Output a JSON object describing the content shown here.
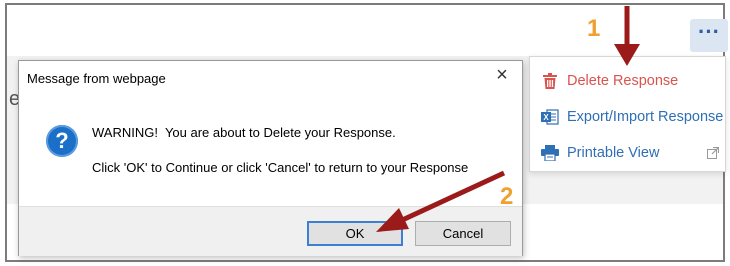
{
  "page": {
    "fragment_text": "e"
  },
  "more_button": {
    "label": "···",
    "icon": "more-horizontal-icon"
  },
  "menu": {
    "items": [
      {
        "label": "Delete Response",
        "icon": "trash-icon",
        "color": "#d9534f"
      },
      {
        "label": "Export/Import Response",
        "icon": "excel-icon",
        "color": "#2e6fb5"
      },
      {
        "label": "Printable View",
        "icon": "printer-icon",
        "color": "#2e6fb5",
        "trailing_icon": "external-link-icon"
      }
    ]
  },
  "dialog": {
    "title": "Message from webpage",
    "close_label": "×",
    "icon": "question-icon",
    "icon_glyph": "?",
    "message_line1": "WARNING!  You are about to Delete your Response.",
    "message_line2": "Click 'OK' to Continue or click 'Cancel' to return to your Response",
    "ok_label": "OK",
    "cancel_label": "Cancel"
  },
  "annotations": {
    "step1": "1",
    "step2": "2",
    "arrow_color": "#9b1b1b",
    "number_color": "#f0a030"
  }
}
